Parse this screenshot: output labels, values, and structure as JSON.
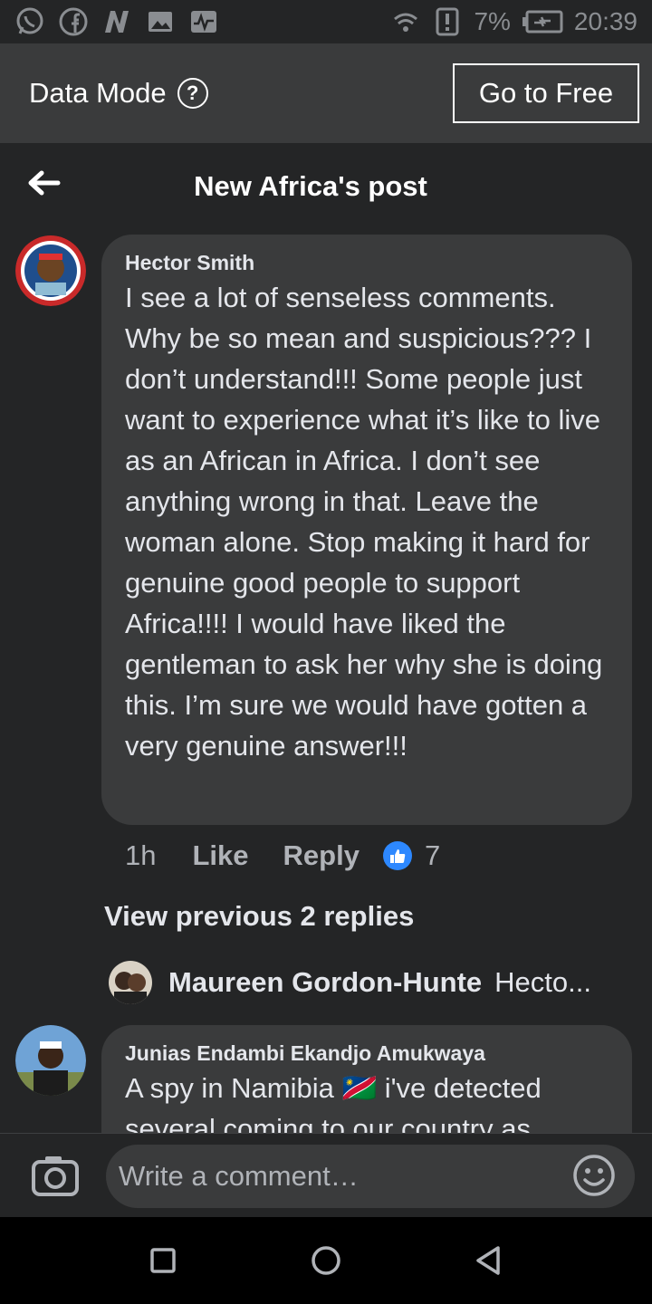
{
  "status_bar": {
    "battery": "7%",
    "time": "20:39",
    "left_icons": [
      "whatsapp-icon",
      "facebook-icon",
      "n-app-icon",
      "image-icon",
      "activity-icon"
    ]
  },
  "data_mode": {
    "label": "Data Mode",
    "help": "?",
    "button": "Go to Free"
  },
  "header": {
    "title": "New Africa's post"
  },
  "comments": [
    {
      "author": "Hector Smith",
      "text": "I see a lot of senseless comments. Why be so mean and suspicious??? I don’t understand!!! Some people just want to experience what it’s like to live as an African in Africa. I don’t see anything wrong in that. Leave the woman alone. Stop making it hard for genuine good people to support Africa!!!! I would have liked the gentleman to ask her why she is doing this. I’m sure we would have gotten a very genuine answer!!!",
      "time": "1h",
      "like": "Like",
      "reply": "Reply",
      "reaction_count": "7"
    },
    {
      "author": "Junias Endambi Ekandjo Amukwaya",
      "text": "A spy in Namibia 🇳🇦 i've detected several coming to our country as"
    }
  ],
  "replies": {
    "view_previous": "View previous 2 replies",
    "preview_author": "Maureen Gordon-Hunte",
    "preview_snippet": "Hecto..."
  },
  "composer": {
    "placeholder": "Write a comment…"
  },
  "colors": {
    "background": "#242526",
    "bubble": "#3a3b3c",
    "data_bar": "#3a3b3c",
    "reaction_blue": "#2d88ff"
  }
}
